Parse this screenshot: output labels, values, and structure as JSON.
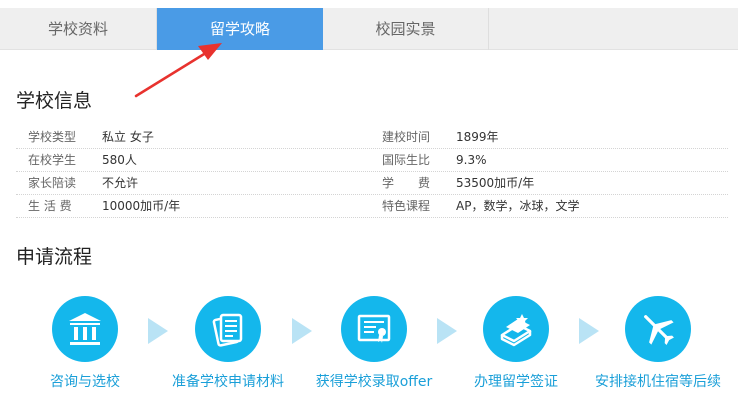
{
  "tabs": [
    {
      "label": "学校资料",
      "active": false
    },
    {
      "label": "留学攻略",
      "active": true
    },
    {
      "label": "校园实景",
      "active": false
    }
  ],
  "school_info": {
    "title": "学校信息",
    "rows": [
      {
        "label1": "学校类型",
        "value1": "私立 女子",
        "label2": "建校时间",
        "value2": "1899年"
      },
      {
        "label1": "在校学生",
        "value1": "580人",
        "label2": "国际生比",
        "value2": "9.3%"
      },
      {
        "label1": "家长陪读",
        "value1": "不允许",
        "label2": "学　　费",
        "value2": "53500加币/年"
      },
      {
        "label1": "生 活 费",
        "value1": "10000加币/年",
        "label2": "特色课程",
        "value2": "AP，数学，冰球，文学"
      }
    ]
  },
  "process": {
    "title": "申请流程",
    "steps": [
      {
        "label": "咨询与选校",
        "icon": "school-building-icon"
      },
      {
        "label": "准备学校申请材料",
        "icon": "documents-icon"
      },
      {
        "label": "获得学校录取offer",
        "icon": "certificate-icon"
      },
      {
        "label": "办理留学签证",
        "icon": "passport-books-icon"
      },
      {
        "label": "安排接机住宿等后续",
        "icon": "airplane-icon"
      }
    ]
  },
  "colors": {
    "active_tab": "#4a9be6",
    "step_circle": "#14b7ec",
    "step_text": "#1a9fd8",
    "annotation_arrow": "#e8322e"
  }
}
